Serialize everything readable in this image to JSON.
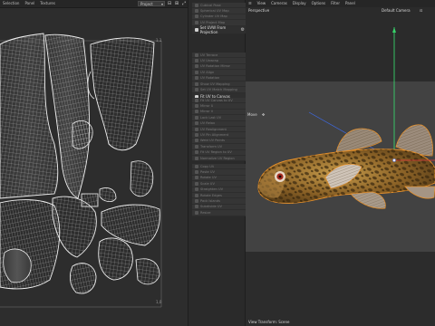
{
  "uv_editor": {
    "menu": [
      "Selection",
      "Panel",
      "Textures"
    ],
    "view_select": "Project",
    "corner_label_top": "1,1",
    "corner_label_bottom": "1,0"
  },
  "tools": {
    "group1": [
      "Cubical Pose",
      "Spherical UV Map",
      "Cylinder UV Map",
      "UV Project Map"
    ],
    "header1": {
      "label": "Set UVW From Projection"
    },
    "group2": [
      "UV Terrace",
      "UV Unwrap",
      "UV Rotation Mirror",
      "UV Align",
      "UV Rotation",
      "Show UV Mapping",
      "Set UV Match Mapping"
    ],
    "header2": {
      "label": "Fit UV to Canvas"
    },
    "group3": [
      "Fit UV Canvas to UV",
      "Mirror U",
      "Mirror V",
      "Lock Last UV",
      "UV Relax",
      "UV Realignment",
      "UV Pin Alignment",
      "Weld UV Points",
      "Transform UV",
      "Fit UV Region to UV",
      "Normalize UV Region"
    ],
    "group4": [
      "Copy UV",
      "Paste UV",
      "Rotate UV",
      "Scale UV",
      "Straighten UV",
      "Rotate Edges",
      "Pack Islands",
      "Subdivide UV",
      "Resize"
    ]
  },
  "viewport": {
    "menu": [
      "View",
      "Cameras",
      "Display",
      "Options",
      "Filter",
      "Panel"
    ],
    "view_name": "Perspective",
    "camera_name": "Default Camera",
    "move_label": "Move",
    "status": "View Transform: Scene"
  },
  "colors": {
    "bg": "#2b2b2b",
    "gizmo_green": "#38d26a",
    "gizmo_blue": "#3d6cf0",
    "gizmo_red": "#e03b3b",
    "selection_orange": "#e9922b"
  }
}
